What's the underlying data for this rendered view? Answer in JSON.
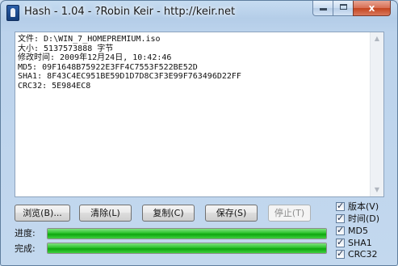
{
  "window": {
    "title": "Hash - 1.04 - ?Robin Keir - http://keir.net"
  },
  "caption_buttons": {
    "close": "x"
  },
  "output": {
    "lines": [
      "文件: D:\\WIN_7_HOMEPREMIUM.iso",
      "大小: 5137573888 字节",
      "修改时间: 2009年12月24日, 10:42:46",
      "MD5: 09F1648B75922E3FF4C7553F522BE52D",
      "SHA1: 8F43C4EC951BE59D1D7D8C3F3E99F763496D22FF",
      "CRC32: 5E984EC8"
    ]
  },
  "buttons": {
    "browse": "浏览(B)...",
    "clear": "清除(L)",
    "copy": "复制(C)",
    "save": "保存(S)",
    "stop": "停止(T)"
  },
  "options": [
    {
      "label": "版本(V)",
      "checked": true
    },
    {
      "label": "时间(D)",
      "checked": true
    },
    {
      "label": "MD5",
      "checked": true
    },
    {
      "label": "SHA1",
      "checked": true
    },
    {
      "label": "CRC32",
      "checked": true
    }
  ],
  "progress": {
    "progress_label": "进度:",
    "complete_label": "完成:",
    "progress_value": 1.0,
    "complete_value": 1.0,
    "fill_color": "#1fbf1f"
  }
}
